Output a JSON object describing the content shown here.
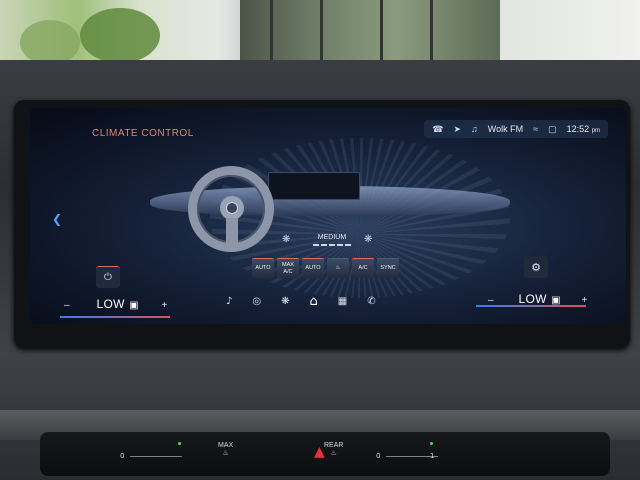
{
  "screen": {
    "title": "CLIMATE CONTROL",
    "status": {
      "radio_station": "Wolk FM",
      "time": "12:52",
      "ampm": "pm"
    },
    "fan": {
      "label": "MEDIUM"
    },
    "buttons": [
      {
        "label": "AUTO",
        "name": "auto-recirc-button"
      },
      {
        "label": "MAX A/C",
        "name": "max-ac-button"
      },
      {
        "label": "AUTO",
        "name": "auto-button"
      },
      {
        "label": "",
        "name": "seat-heat-button"
      },
      {
        "label": "A/C",
        "name": "ac-button"
      },
      {
        "label": "SYNC",
        "name": "sync-button"
      }
    ],
    "left_temp": {
      "value": "LOW",
      "minus": "–",
      "plus": "+"
    },
    "right_temp": {
      "value": "LOW",
      "minus": "–",
      "plus": "+"
    }
  },
  "lower_panel": {
    "left_slider_min": "0",
    "max_label": "MAX",
    "rear_label": "REAR",
    "right_slider_min": "0",
    "right_slider_max": "1"
  },
  "colors": {
    "title": "#d98a7a",
    "accent_red": "#e06a5a",
    "accent_blue": "#2f7dff",
    "hazard": "#e8303a"
  }
}
